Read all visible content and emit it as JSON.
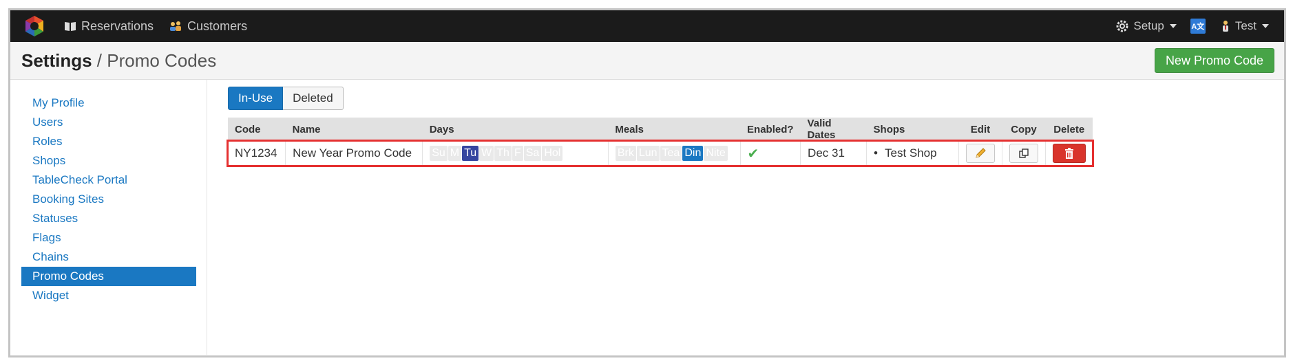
{
  "nav": {
    "reservations": "Reservations",
    "customers": "Customers",
    "setup": "Setup",
    "lang_icon_text": "A文",
    "user": "Test"
  },
  "header": {
    "title_bold": "Settings",
    "title_sep": " / ",
    "title_sub": "Promo Codes",
    "new_button": "New Promo Code"
  },
  "sidebar": {
    "items": [
      {
        "label": "My Profile"
      },
      {
        "label": "Users"
      },
      {
        "label": "Roles"
      },
      {
        "label": "Shops"
      },
      {
        "label": "TableCheck Portal"
      },
      {
        "label": "Booking Sites"
      },
      {
        "label": "Statuses"
      },
      {
        "label": "Flags"
      },
      {
        "label": "Chains"
      },
      {
        "label": "Promo Codes"
      },
      {
        "label": "Widget"
      }
    ],
    "active": "Promo Codes"
  },
  "toggle": {
    "in_use": "In-Use",
    "deleted": "Deleted"
  },
  "table": {
    "headers": [
      "Code",
      "Name",
      "Days",
      "Meals",
      "Enabled?",
      "Valid Dates",
      "Shops",
      "Edit",
      "Copy",
      "Delete"
    ],
    "rows": [
      {
        "code": "NY1234",
        "name": "New Year Promo Code",
        "days": [
          "Su",
          "M",
          "Tu",
          "W",
          "Th",
          "F",
          "Sa",
          "Hol"
        ],
        "days_active": [
          "Tu"
        ],
        "meals": [
          "Brk",
          "Lun",
          "Tea",
          "Din",
          "Nite"
        ],
        "meals_active": [
          "Din"
        ],
        "enabled_mark": "✔",
        "valid_dates": "Dec 31",
        "shops": [
          "Test Shop"
        ]
      }
    ]
  },
  "colors": {
    "brand_blue": "#1a78c2",
    "active_day": "#3545a0",
    "new_button_green": "#47a447",
    "delete_red": "#d9342b",
    "highlight_outline": "#e53030"
  },
  "icons": {
    "edit": "pencil-icon",
    "copy": "copy-icon",
    "delete": "trash-icon"
  }
}
